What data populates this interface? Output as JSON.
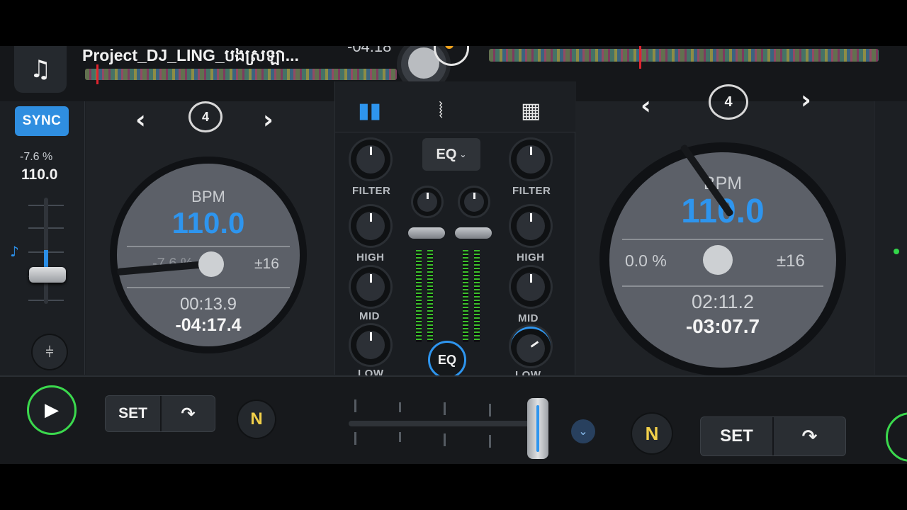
{
  "header": {
    "track_title": "Project_DJ_LING_បងស្រឡា...",
    "top_time": "-04:18"
  },
  "left_deck": {
    "sync_label": "SYNC",
    "pitch_percent": "-7.6 %",
    "pitch_value": "110.0",
    "loop_count": "4",
    "bpm_label": "BPM",
    "bpm_value": "110.0",
    "pitch_offset": "-7.6 %",
    "pitch_range": "±16",
    "elapsed": "00:13.9",
    "remaining": "-04:17.4",
    "set_label": "SET"
  },
  "right_deck": {
    "loop_count": "4",
    "bpm_label": "BPM",
    "bpm_value": "110.0",
    "pitch_offset": "0.0 %",
    "pitch_range": "±16",
    "elapsed": "02:11.2",
    "remaining": "-03:07.7",
    "set_label": "SET"
  },
  "mixer": {
    "eq_dropdown": "EQ",
    "eq_button": "EQ",
    "left_labels": {
      "filter": "FILTER",
      "high": "HIGH",
      "mid": "MID",
      "low": "LOW"
    },
    "right_labels": {
      "filter": "FILTER",
      "high": "HIGH",
      "mid": "MID",
      "low": "LOW"
    }
  },
  "icons": {
    "music": "music-note-icon",
    "prev": "chevron-left-icon",
    "next": "chevron-right-icon",
    "loop": "loop-icon",
    "mixer_tab": "mixer-levels-icon",
    "waveform_tab": "waveform-icon",
    "pads_tab": "grid-pads-icon",
    "play": "play-icon",
    "cue_jump": "cue-jump-icon",
    "neural_mix": "neural-mix-icon",
    "eq_settings": "sliders-icon"
  },
  "colors": {
    "accent": "#2e95ee",
    "play": "#3bd94d",
    "meter": "#3cbf2b",
    "marker": "#e0242e"
  },
  "glyphs": {
    "music": "♫",
    "prev": "‹",
    "next": "›",
    "play": "▶",
    "cue_jump": "↷",
    "note": "♪",
    "sliders": "⫩",
    "chevron_down": "⌄",
    "n_logo": "N",
    "waveform": "⦚",
    "pads": "▦",
    "levels": "▮▮"
  }
}
